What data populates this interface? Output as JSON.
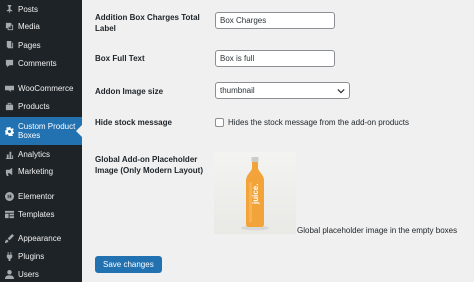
{
  "sidebar": {
    "items": [
      {
        "label": "Posts",
        "icon": "pin-icon"
      },
      {
        "label": "Media",
        "icon": "media-icon"
      },
      {
        "label": "Pages",
        "icon": "pages-icon"
      },
      {
        "label": "Comments",
        "icon": "comments-icon"
      },
      {
        "label": "WooCommerce",
        "icon": "woocommerce-icon"
      },
      {
        "label": "Products",
        "icon": "products-icon"
      },
      {
        "label": "Custom Product Boxes",
        "icon": "gear-icon",
        "active": true
      },
      {
        "label": "Analytics",
        "icon": "analytics-icon"
      },
      {
        "label": "Marketing",
        "icon": "megaphone-icon"
      },
      {
        "label": "Elementor",
        "icon": "elementor-icon"
      },
      {
        "label": "Templates",
        "icon": "templates-icon"
      },
      {
        "label": "Appearance",
        "icon": "brush-icon"
      },
      {
        "label": "Plugins",
        "icon": "plugins-icon"
      },
      {
        "label": "Users",
        "icon": "users-icon"
      }
    ],
    "active_color": "#2271b1",
    "background_color": "#1d2327"
  },
  "settings": {
    "box_charges_label": {
      "label": "Addition Box Charges Total Label",
      "value": "Box Charges"
    },
    "box_full_text": {
      "label": "Box Full Text",
      "value": "Box is full"
    },
    "addon_image_size": {
      "label": "Addon Image size",
      "selected": "thumbnail"
    },
    "hide_stock_message": {
      "label": "Hide stock message",
      "checked": false,
      "description": "Hides the stock message from the add-on products"
    },
    "global_placeholder": {
      "label": "Global Add-on Placeholder Image (Only Modern Layout)",
      "image_text": "juice.",
      "caption": "Global placeholder image in the empty boxes"
    }
  },
  "save_button": {
    "label": "Save changes",
    "color": "#2271b1"
  }
}
